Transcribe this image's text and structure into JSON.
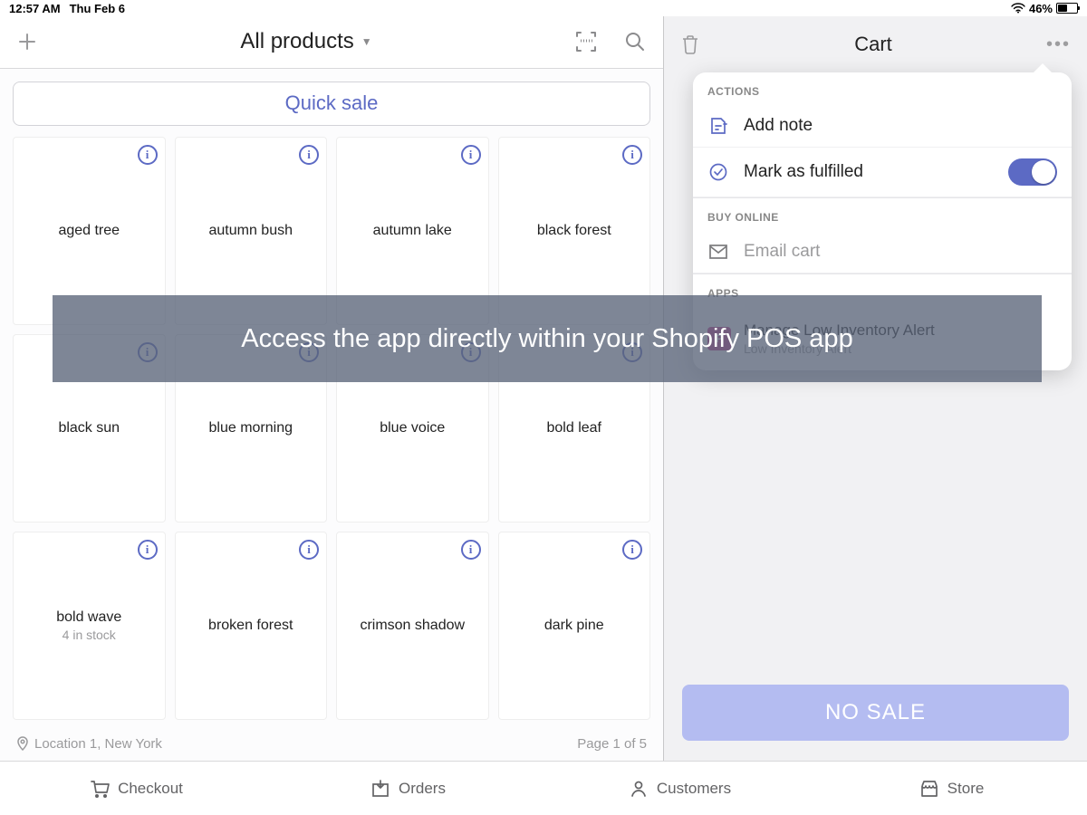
{
  "status": {
    "time": "12:57 AM",
    "date": "Thu Feb 6",
    "battery": "46%"
  },
  "header": {
    "title": "All products"
  },
  "quick_sale": "Quick sale",
  "products": [
    {
      "name": "aged tree",
      "sub": ""
    },
    {
      "name": "autumn bush",
      "sub": ""
    },
    {
      "name": "autumn lake",
      "sub": ""
    },
    {
      "name": "black forest",
      "sub": ""
    },
    {
      "name": "black sun",
      "sub": ""
    },
    {
      "name": "blue morning",
      "sub": ""
    },
    {
      "name": "blue voice",
      "sub": ""
    },
    {
      "name": "bold leaf",
      "sub": ""
    },
    {
      "name": "bold wave",
      "sub": "4 in stock"
    },
    {
      "name": "broken forest",
      "sub": ""
    },
    {
      "name": "crimson shadow",
      "sub": ""
    },
    {
      "name": "dark pine",
      "sub": ""
    }
  ],
  "footer": {
    "location": "Location 1, New York",
    "page": "Page 1 of 5"
  },
  "cart": {
    "title": "Cart",
    "no_sale": "NO SALE"
  },
  "popover": {
    "actions_label": "ACTIONS",
    "add_note": "Add note",
    "fulfilled": "Mark as fulfilled",
    "buy_online_label": "BUY ONLINE",
    "email_cart": "Email cart",
    "apps_label": "APPS",
    "app_name": "Manage Low Inventory Alert",
    "app_sub": "Low Inventory Alert"
  },
  "banner": "Access the app directly within your Shopify POS app",
  "tabs": {
    "checkout": "Checkout",
    "orders": "Orders",
    "customers": "Customers",
    "store": "Store"
  }
}
